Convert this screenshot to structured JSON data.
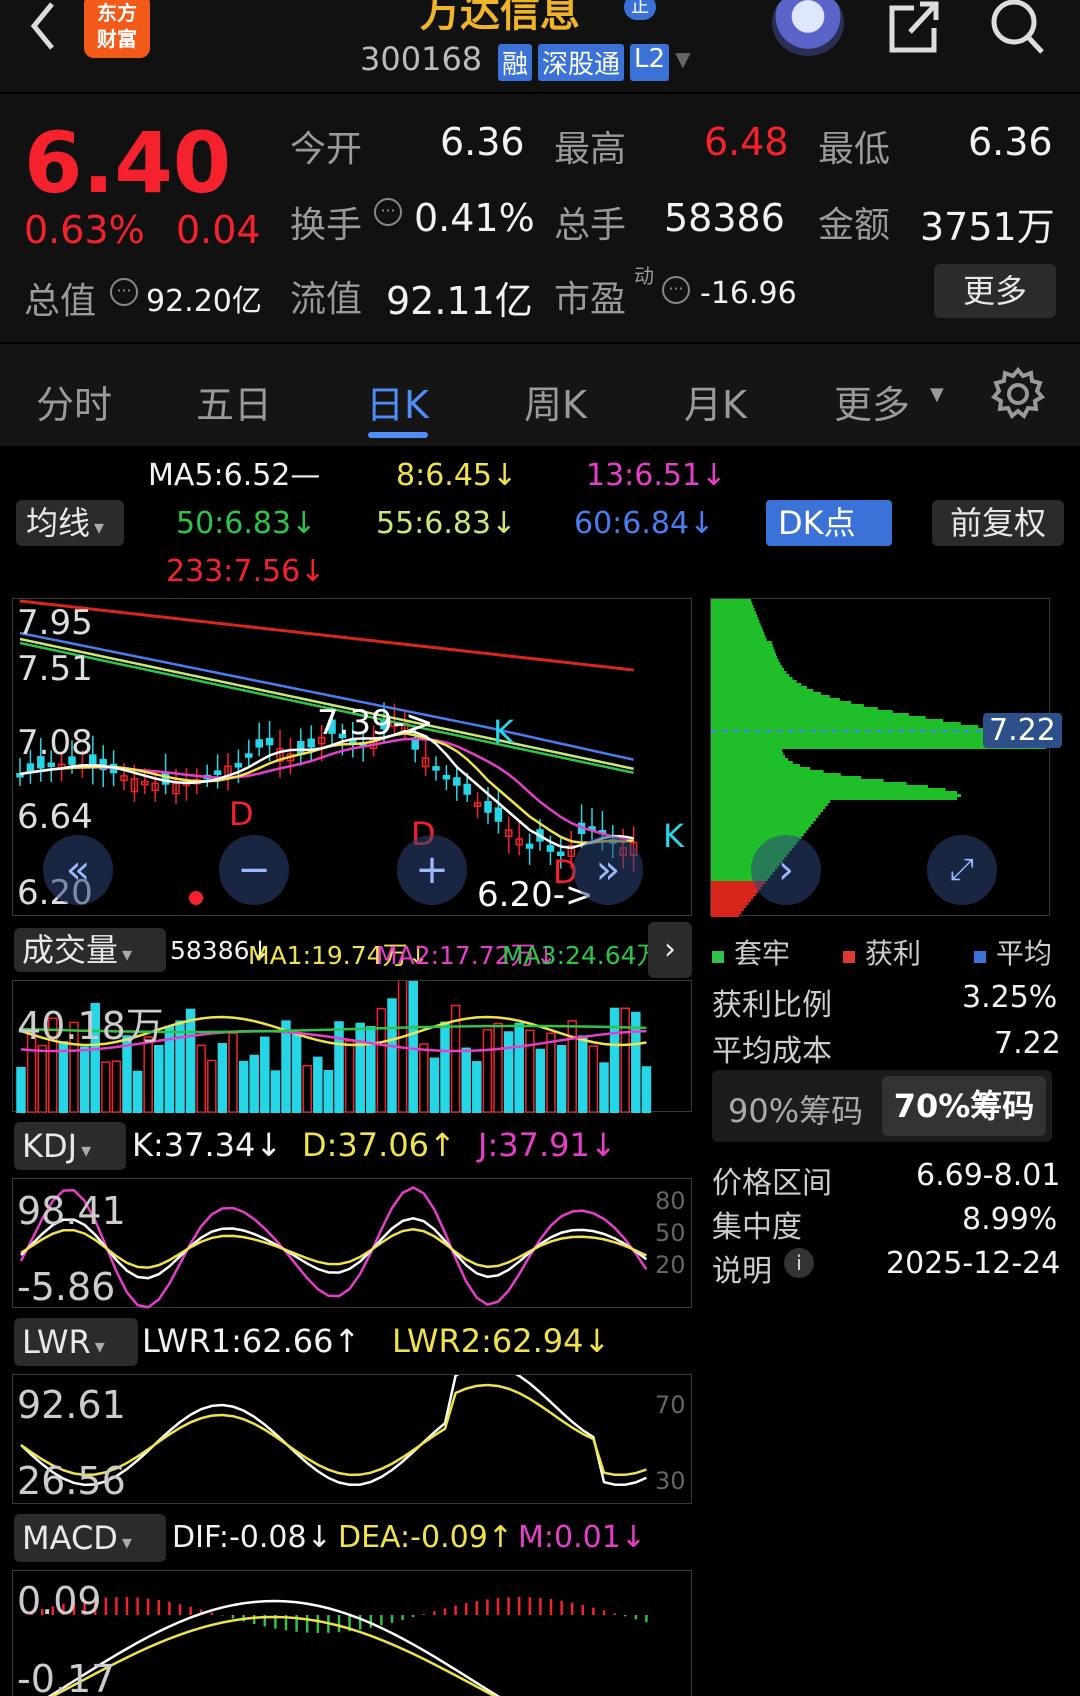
{
  "header": {
    "back_icon": "chevron-left-icon",
    "brand_logo": "东方财富",
    "stock_name": "万达信息",
    "stock_code": "300168",
    "tags": [
      "融",
      "深股通",
      "L2"
    ],
    "zheng_badge": "正"
  },
  "quote": {
    "price": "6.40",
    "change_pct": "0.63%",
    "change": "0.04",
    "open_label": "今开",
    "open": "6.36",
    "high_label": "最高",
    "high": "6.48",
    "low_label": "最低",
    "low": "6.36",
    "turnover_label": "换手",
    "turnover": "0.41%",
    "volume_label": "总手",
    "volume": "58386",
    "amount_label": "金额",
    "amount": "3751万",
    "mktcap_label": "总值",
    "mktcap": "92.20亿",
    "float_label": "流值",
    "float_cap": "92.11亿",
    "pe_label": "市盈",
    "pe_sup": "动",
    "pe": "-16.96",
    "more_label": "更多"
  },
  "tabs": [
    "分时",
    "五日",
    "日K",
    "周K",
    "月K",
    "更多"
  ],
  "active_tab": 2,
  "ma_legend": {
    "ma5": "MA5:6.52—",
    "ma8": "8:6.45↓",
    "ma13": "13:6.51↓",
    "ma50": "50:6.83↓",
    "ma55": "55:6.83↓",
    "ma60": "60:6.84↓",
    "ma233": "233:7.56↓"
  },
  "controls": {
    "ma_select": "均线",
    "dk_button": "DK点",
    "fq_button": "前复权"
  },
  "kline": {
    "y_labels": [
      "7.95",
      "7.51",
      "7.08",
      "6.64",
      "6.20"
    ],
    "annotations": {
      "high_mark": "7.39->",
      "low_mark": "6.20->",
      "k": "K",
      "d": "D"
    }
  },
  "chips": {
    "avg_price": "7.22",
    "legend": [
      "套牢",
      "获利",
      "平均"
    ],
    "profit_ratio_label": "获利比例",
    "profit_ratio": "3.25%",
    "avg_cost_label": "平均成本",
    "avg_cost": "7.22",
    "tab90": "90%筹码",
    "tab70": "70%筹码",
    "range_label": "价格区间",
    "range": "6.69-8.01",
    "concentration_label": "集中度",
    "concentration": "8.99%",
    "note_label": "说明",
    "note_date": "2025-12-24"
  },
  "volume": {
    "select": "成交量",
    "vol": "58386↓",
    "ma1": "MA1:19.74万↓",
    "ma2": "MA2:17.72万↓",
    "ma3": "MA3:24.64万↓",
    "y_label": "40.18万"
  },
  "kdj": {
    "select": "KDJ",
    "k": "K:37.34↓",
    "d": "D:37.06↑",
    "j": "J:37.91↓",
    "y_top": "98.41",
    "y_bottom": "-5.86",
    "levels": [
      "80",
      "50",
      "20"
    ]
  },
  "lwr": {
    "select": "LWR",
    "lwr1": "LWR1:62.66↑",
    "lwr2": "LWR2:62.94↓",
    "y_top": "92.61",
    "y_bottom": "26.56",
    "levels": [
      "70",
      "30"
    ]
  },
  "macd": {
    "select": "MACD",
    "dif": "DIF:-0.08↓",
    "dea": "DEA:-0.09↑",
    "m": "M:0.01↓",
    "y_top": "0.09",
    "y_bottom": "-0.17"
  },
  "colors": {
    "up": "#f5222d",
    "down": "#27d6e6",
    "ma5": "#ffffff",
    "ma8": "#f0e24a",
    "ma13": "#e63ec8",
    "ma50": "#2ec44a",
    "ma55": "#c8e87a",
    "ma60": "#4a7df0",
    "ma233": "#d9261c",
    "accent": "#3a72d8"
  }
}
